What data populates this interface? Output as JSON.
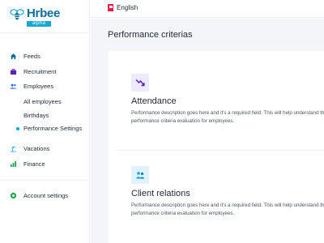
{
  "app": {
    "logo_name": "Hrbee",
    "logo_badge": "alpha",
    "brand_color": "#0b6e99",
    "accent_color": "#14a8d6"
  },
  "sidebar": {
    "items": [
      {
        "label": "Feeds",
        "icon": "home-icon",
        "color": "#0b6e99"
      },
      {
        "label": "Recruitment",
        "icon": "briefcase-icon",
        "color": "#5b21b6"
      },
      {
        "label": "Employees",
        "icon": "users-icon",
        "color": "#2563eb"
      },
      {
        "label": "Vacations",
        "icon": "beach-icon",
        "color": "#0ea5e9"
      },
      {
        "label": "Finance",
        "icon": "bar-chart-icon",
        "color": "#16a34a"
      },
      {
        "label": "Account settings",
        "icon": "settings-icon",
        "color": "#16a34a"
      }
    ],
    "employee_subitems": [
      {
        "label": "All employees"
      },
      {
        "label": "Birthdays"
      },
      {
        "label": "Performance Settings",
        "active": true
      }
    ]
  },
  "topbar": {
    "language": "English",
    "language_flag_icon": "flag-icon"
  },
  "main": {
    "title": "Performance criterias",
    "criteria": [
      {
        "title": "Attendance",
        "icon": "trend-down-icon",
        "icon_bg": "#ede9fe",
        "description": "Performance description goes here and it's a required field. This will help understand the performance criteria evaluation for employees."
      },
      {
        "title": "Client relations",
        "icon": "people-chat-icon",
        "icon_bg": "#e0f2fe",
        "description": "Performance description goes here and it's a required field. This will help understand the performance criteria evaluation for employees."
      }
    ]
  }
}
